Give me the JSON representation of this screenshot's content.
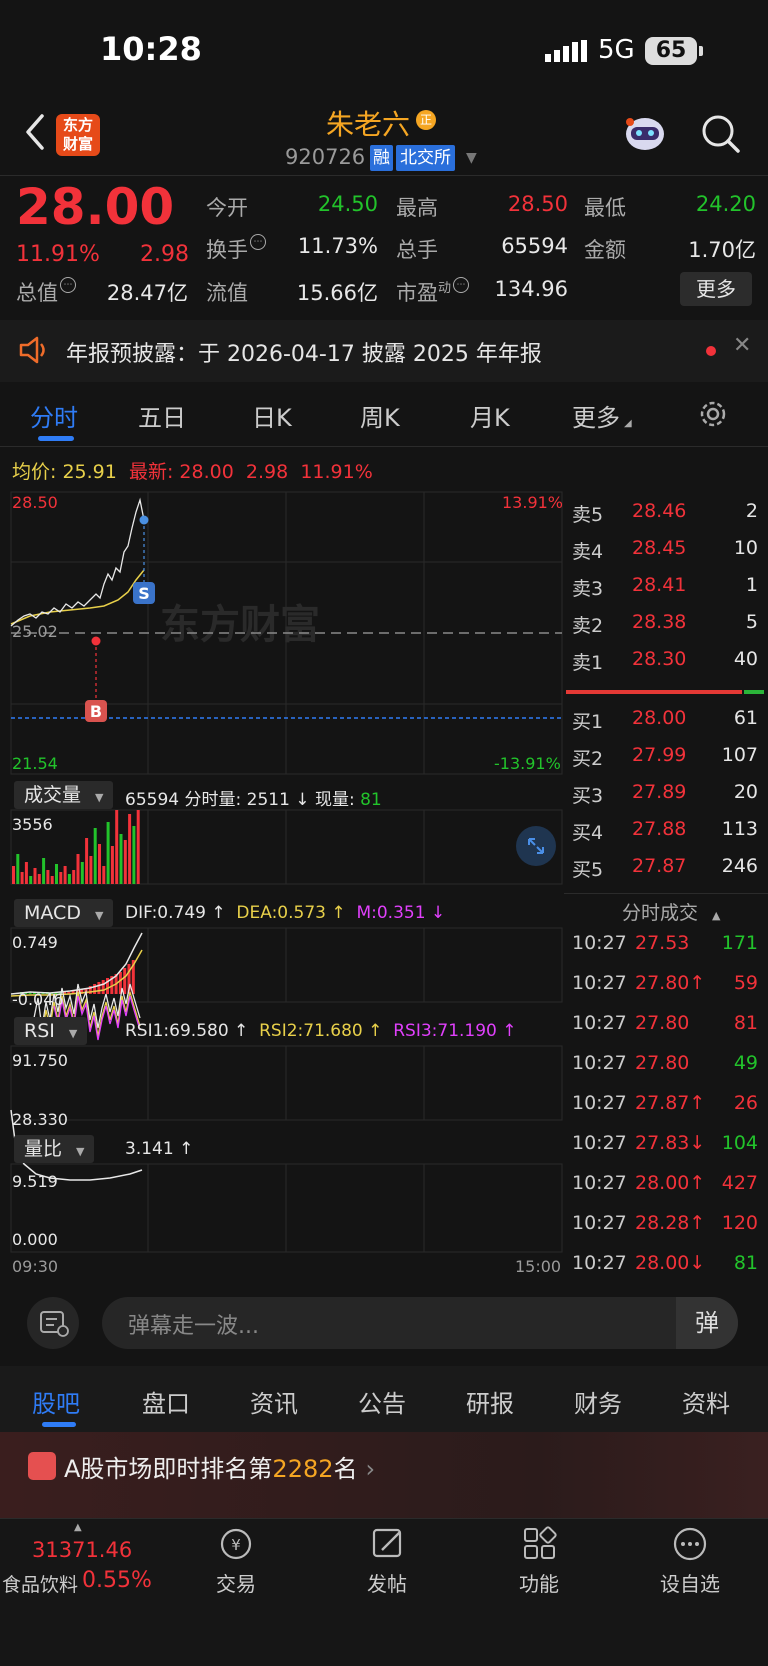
{
  "status": {
    "time": "10:28",
    "network": "5G",
    "battery": "65"
  },
  "header": {
    "logo_text_1": "东方",
    "logo_text_2": "财富",
    "name": "朱老六",
    "name_badge": "正",
    "code": "920726",
    "tag_rong": "融",
    "tag_exchange": "北交所"
  },
  "quote": {
    "price": "28.00",
    "pct": "11.91%",
    "change": "2.98",
    "open_label": "今开",
    "open": "24.50",
    "high_label": "最高",
    "high": "28.50",
    "low_label": "最低",
    "low": "24.20",
    "turnover_label": "换手",
    "turnover": "11.73%",
    "volume_label": "总手",
    "volume": "65594",
    "amount_label": "金额",
    "amount": "1.70亿",
    "mktcap_label": "总值",
    "mktcap": "28.47亿",
    "float_label": "流值",
    "float": "15.66亿",
    "pe_label": "市盈",
    "pe_sup": "动",
    "pe": "134.96",
    "more": "更多"
  },
  "notice": {
    "text": "年报预披露：于 2026-04-17 披露 2025 年年报"
  },
  "tabs": [
    "分时",
    "五日",
    "日K",
    "周K",
    "月K",
    "更多"
  ],
  "chart": {
    "avg_label": "均价:",
    "avg": "25.91",
    "latest_label": "最新:",
    "latest": "28.00",
    "latest_chg": "2.98",
    "latest_pct": "11.91%",
    "price_top": "28.50",
    "price_mid": "25.02",
    "price_bottom": "21.54",
    "pct_top": "13.91%",
    "pct_bottom": "-13.91%",
    "watermark": "东方财富",
    "marker_b": "B",
    "marker_s": "S",
    "time_start": "09:30",
    "time_end": "15:00",
    "colors": {
      "price_line": "#e8e8e8",
      "avg_line": "#e8d04a",
      "up": "#f2323a",
      "down": "#22c32b"
    }
  },
  "indicators": {
    "volume": {
      "name": "成交量",
      "total": "65594",
      "detail": "分时量: 2511 ↓ 现量:",
      "now": "81",
      "max": "3556"
    },
    "macd": {
      "name": "MACD",
      "dif": "DIF:0.749 ↑",
      "dea": "DEA:0.573 ↑",
      "m": "M:0.351 ↓",
      "top": "0.749",
      "bottom": "-0.046"
    },
    "rsi": {
      "name": "RSI",
      "rsi1": "RSI1:69.580 ↑",
      "rsi2": "RSI2:71.680 ↑",
      "rsi3": "RSI3:71.190 ↑",
      "top": "91.750",
      "bottom": "28.330"
    },
    "vr": {
      "name": "量比",
      "value": "3.141 ↑",
      "top": "9.519",
      "bottom": "0.000"
    }
  },
  "orderbook": {
    "asks": [
      {
        "label": "卖5",
        "price": "28.46",
        "vol": "2"
      },
      {
        "label": "卖4",
        "price": "28.45",
        "vol": "10"
      },
      {
        "label": "卖3",
        "price": "28.41",
        "vol": "1"
      },
      {
        "label": "卖2",
        "price": "28.38",
        "vol": "5"
      },
      {
        "label": "卖1",
        "price": "28.30",
        "vol": "40"
      }
    ],
    "bids": [
      {
        "label": "买1",
        "price": "28.00",
        "vol": "61"
      },
      {
        "label": "买2",
        "price": "27.99",
        "vol": "107"
      },
      {
        "label": "买3",
        "price": "27.89",
        "vol": "20"
      },
      {
        "label": "买4",
        "price": "27.88",
        "vol": "113"
      },
      {
        "label": "买5",
        "price": "27.87",
        "vol": "246"
      }
    ]
  },
  "ticks": {
    "title": "分时成交",
    "rows": [
      {
        "time": "10:27",
        "price": "27.53",
        "vol": "171",
        "dir": "down"
      },
      {
        "time": "10:27",
        "price": "27.80↑",
        "vol": "59",
        "dir": "up"
      },
      {
        "time": "10:27",
        "price": "27.80",
        "vol": "81",
        "dir": "up"
      },
      {
        "time": "10:27",
        "price": "27.80",
        "vol": "49",
        "dir": "down"
      },
      {
        "time": "10:27",
        "price": "27.87↑",
        "vol": "26",
        "dir": "up"
      },
      {
        "time": "10:27",
        "price": "27.83↓",
        "vol": "104",
        "dir": "down"
      },
      {
        "time": "10:27",
        "price": "28.00↑",
        "vol": "427",
        "dir": "up"
      },
      {
        "time": "10:27",
        "price": "28.28↑",
        "vol": "120",
        "dir": "up"
      },
      {
        "time": "10:27",
        "price": "28.00↓",
        "vol": "81",
        "dir": "down"
      }
    ]
  },
  "danmu": {
    "placeholder": "弹幕走一波...",
    "send": "弹"
  },
  "bottom_tabs": [
    "股吧",
    "盘口",
    "资讯",
    "公告",
    "研报",
    "财务",
    "资料"
  ],
  "rank": {
    "prefix": "A股市场即时排名第",
    "number": "2282",
    "suffix": "名"
  },
  "bottom_nav": {
    "index_value": "31371.46",
    "index_name": "食品饮料",
    "index_pct": "0.55%",
    "items": [
      "交易",
      "发帖",
      "功能",
      "设自选"
    ]
  }
}
